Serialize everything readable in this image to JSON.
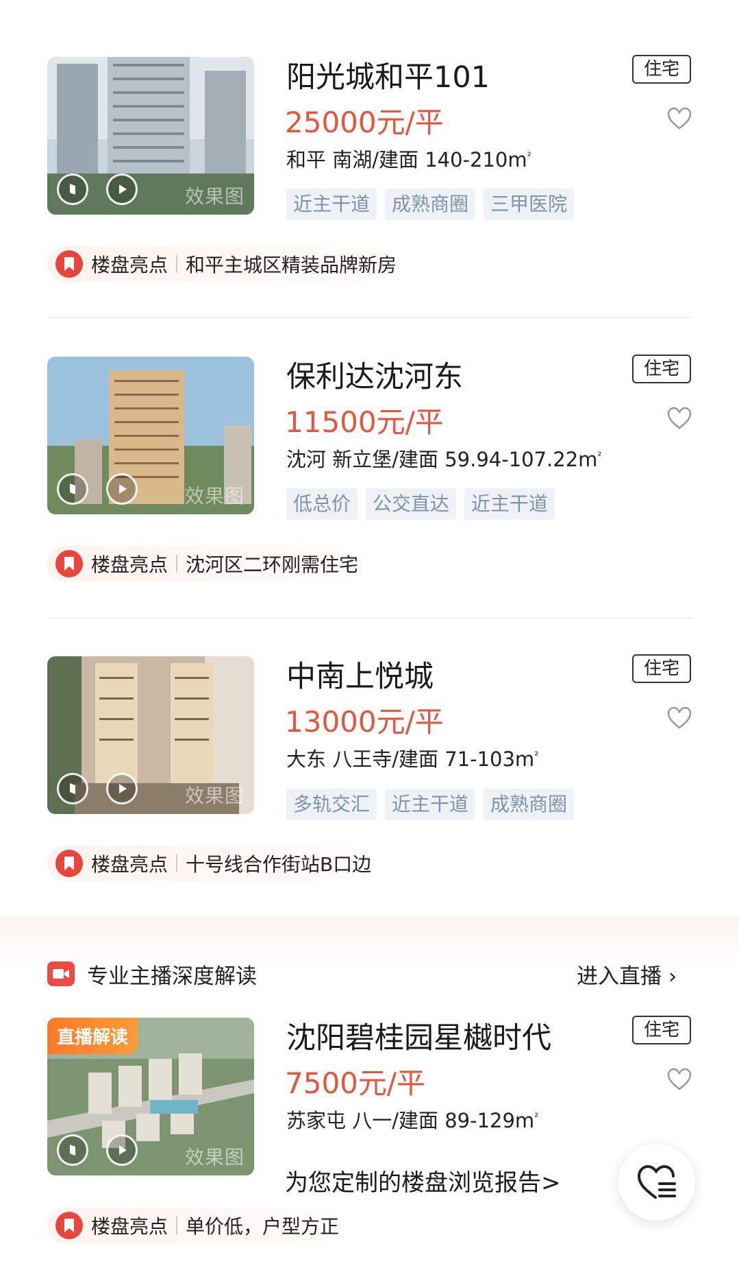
{
  "listings": [
    {
      "title": "阳光城和平101",
      "type": "住宅",
      "price": "25000元/平",
      "meta": "和平 南湖/建面 140-210m",
      "area_unit_sup": "²",
      "tags": [
        "近主干道",
        "成熟商圈",
        "三甲医院"
      ],
      "highlight_label": "楼盘亮点",
      "highlight_text": "和平主城区精装品牌新房",
      "watermark": "效果图"
    },
    {
      "title": "保利达沈河东",
      "type": "住宅",
      "price": "11500元/平",
      "meta": "沈河 新立堡/建面 59.94-107.22m",
      "area_unit_sup": "²",
      "tags": [
        "低总价",
        "公交直达",
        "近主干道"
      ],
      "highlight_label": "楼盘亮点",
      "highlight_text": "沈河区二环刚需住宅",
      "watermark": "效果图"
    },
    {
      "title": "中南上悦城",
      "type": "住宅",
      "price": "13000元/平",
      "meta": "大东 八王寺/建面 71-103m",
      "area_unit_sup": "²",
      "tags": [
        "多轨交汇",
        "近主干道",
        "成熟商圈"
      ],
      "highlight_label": "楼盘亮点",
      "highlight_text": "十号线合作街站B口边",
      "watermark": "效果图"
    },
    {
      "title": "沈阳碧桂园星樾时代",
      "type": "住宅",
      "price": "7500元/平",
      "meta": "苏家屯 八一/建面 89-129m",
      "area_unit_sup": "²",
      "badge": "直播解读",
      "highlight_label": "楼盘亮点",
      "highlight_text": "单价低，户型方正",
      "watermark": "效果图"
    }
  ],
  "live_section": {
    "header": "专业主播深度解读",
    "enter_label": "进入直播 ›"
  },
  "report_link": "为您定制的楼盘浏览报告>",
  "icons": {
    "favorite": "heart-outline-icon",
    "panorama": "vr-panorama-icon",
    "play": "play-icon",
    "highlight": "bookmark-icon",
    "live": "video-camera-icon",
    "float": "heart-list-icon"
  },
  "colors": {
    "price": "#e8553d",
    "tag_text": "#8093ab",
    "tag_bg": "#eef2f7",
    "accent": "#e8453d"
  }
}
